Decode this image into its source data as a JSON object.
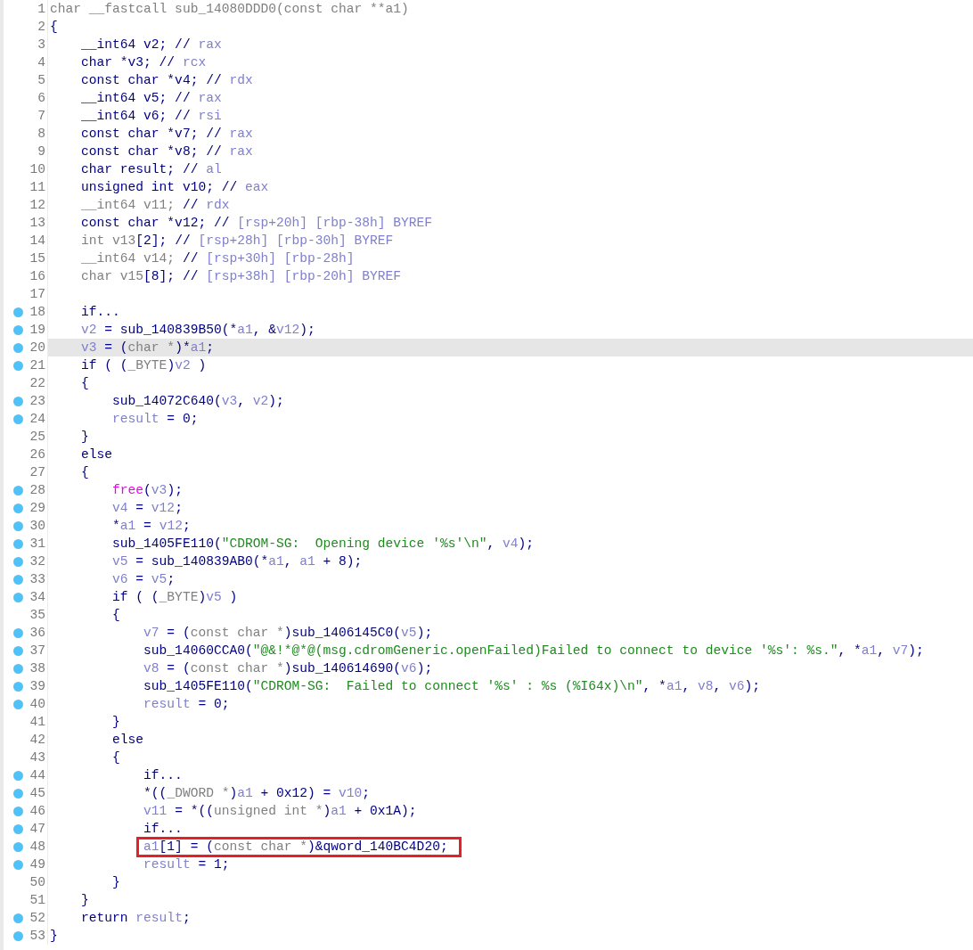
{
  "lines": [
    {
      "number": "1",
      "breakpoint": false,
      "highlighted": false,
      "boxed": false,
      "tokens": [
        {
          "kind": "gray",
          "text": "char __fastcall sub_14080DDD0(const char **a1)"
        }
      ]
    },
    {
      "number": "2",
      "breakpoint": false,
      "highlighted": false,
      "boxed": false,
      "tokens": [
        {
          "kind": "code",
          "text": "{"
        }
      ]
    },
    {
      "number": "3",
      "breakpoint": false,
      "highlighted": false,
      "boxed": false,
      "tokens": [
        {
          "kind": "code",
          "text": "    __int64 v2; // "
        },
        {
          "kind": "var",
          "text": "rax"
        }
      ]
    },
    {
      "number": "4",
      "breakpoint": false,
      "highlighted": false,
      "boxed": false,
      "tokens": [
        {
          "kind": "code",
          "text": "    char *v3; // "
        },
        {
          "kind": "var",
          "text": "rcx"
        }
      ]
    },
    {
      "number": "5",
      "breakpoint": false,
      "highlighted": false,
      "boxed": false,
      "tokens": [
        {
          "kind": "code",
          "text": "    const char *v4; // "
        },
        {
          "kind": "var",
          "text": "rdx"
        }
      ]
    },
    {
      "number": "6",
      "breakpoint": false,
      "highlighted": false,
      "boxed": false,
      "tokens": [
        {
          "kind": "code",
          "text": "    __int64 v5; // "
        },
        {
          "kind": "var",
          "text": "rax"
        }
      ]
    },
    {
      "number": "7",
      "breakpoint": false,
      "highlighted": false,
      "boxed": false,
      "tokens": [
        {
          "kind": "code",
          "text": "    __int64 v6; // "
        },
        {
          "kind": "var",
          "text": "rsi"
        }
      ]
    },
    {
      "number": "8",
      "breakpoint": false,
      "highlighted": false,
      "boxed": false,
      "tokens": [
        {
          "kind": "code",
          "text": "    const char *v7; // "
        },
        {
          "kind": "var",
          "text": "rax"
        }
      ]
    },
    {
      "number": "9",
      "breakpoint": false,
      "highlighted": false,
      "boxed": false,
      "tokens": [
        {
          "kind": "code",
          "text": "    const char *v8; // "
        },
        {
          "kind": "var",
          "text": "rax"
        }
      ]
    },
    {
      "number": "10",
      "breakpoint": false,
      "highlighted": false,
      "boxed": false,
      "tokens": [
        {
          "kind": "code",
          "text": "    char result; // "
        },
        {
          "kind": "var",
          "text": "al"
        }
      ]
    },
    {
      "number": "11",
      "breakpoint": false,
      "highlighted": false,
      "boxed": false,
      "tokens": [
        {
          "kind": "code",
          "text": "    unsigned int v10; // "
        },
        {
          "kind": "var",
          "text": "eax"
        }
      ]
    },
    {
      "number": "12",
      "breakpoint": false,
      "highlighted": false,
      "boxed": false,
      "tokens": [
        {
          "kind": "gray",
          "text": "    __int64 v11;"
        },
        {
          "kind": "code",
          "text": " // "
        },
        {
          "kind": "var",
          "text": "rdx"
        }
      ]
    },
    {
      "number": "13",
      "breakpoint": false,
      "highlighted": false,
      "boxed": false,
      "tokens": [
        {
          "kind": "code",
          "text": "    const char *v12; // "
        },
        {
          "kind": "var",
          "text": "[rsp+20h] [rbp-38h] BYREF"
        }
      ]
    },
    {
      "number": "14",
      "breakpoint": false,
      "highlighted": false,
      "boxed": false,
      "tokens": [
        {
          "kind": "gray",
          "text": "    int v13"
        },
        {
          "kind": "code",
          "text": "[2]; // "
        },
        {
          "kind": "var",
          "text": "[rsp+28h] [rbp-30h] BYREF"
        }
      ]
    },
    {
      "number": "15",
      "breakpoint": false,
      "highlighted": false,
      "boxed": false,
      "tokens": [
        {
          "kind": "gray",
          "text": "    __int64 v14;"
        },
        {
          "kind": "code",
          "text": " // "
        },
        {
          "kind": "var",
          "text": "[rsp+30h] [rbp-28h]"
        }
      ]
    },
    {
      "number": "16",
      "breakpoint": false,
      "highlighted": false,
      "boxed": false,
      "tokens": [
        {
          "kind": "gray",
          "text": "    char v15"
        },
        {
          "kind": "code",
          "text": "[8]; // "
        },
        {
          "kind": "var",
          "text": "[rsp+38h] [rbp-20h] BYREF"
        }
      ]
    },
    {
      "number": "17",
      "breakpoint": false,
      "highlighted": false,
      "boxed": false
    },
    {
      "number": "18",
      "breakpoint": true,
      "highlighted": false,
      "boxed": false,
      "tokens": [
        {
          "kind": "code",
          "text": "    if..."
        }
      ]
    },
    {
      "number": "19",
      "breakpoint": true,
      "highlighted": false,
      "boxed": false,
      "tokens": [
        {
          "kind": "var",
          "text": "    v2"
        },
        {
          "kind": "code",
          "text": " = sub_140839B50(*"
        },
        {
          "kind": "var",
          "text": "a1"
        },
        {
          "kind": "code",
          "text": ", &"
        },
        {
          "kind": "var",
          "text": "v12"
        },
        {
          "kind": "code",
          "text": ");"
        }
      ]
    },
    {
      "number": "20",
      "breakpoint": true,
      "highlighted": true,
      "boxed": false,
      "tokens": [
        {
          "kind": "var",
          "text": "    v3"
        },
        {
          "kind": "code",
          "text": " = ("
        },
        {
          "kind": "gray",
          "text": "char *"
        },
        {
          "kind": "code",
          "text": ")*"
        },
        {
          "kind": "var",
          "text": "a1"
        },
        {
          "kind": "code",
          "text": ";"
        }
      ]
    },
    {
      "number": "21",
      "breakpoint": true,
      "highlighted": false,
      "boxed": false,
      "tokens": [
        {
          "kind": "code",
          "text": "    if ( ("
        },
        {
          "kind": "gray",
          "text": "_BYTE"
        },
        {
          "kind": "code",
          "text": ")"
        },
        {
          "kind": "var",
          "text": "v2"
        },
        {
          "kind": "code",
          "text": " )"
        }
      ]
    },
    {
      "number": "22",
      "breakpoint": false,
      "highlighted": false,
      "boxed": false,
      "tokens": [
        {
          "kind": "code",
          "text": "    {"
        }
      ]
    },
    {
      "number": "23",
      "breakpoint": true,
      "highlighted": false,
      "boxed": false,
      "tokens": [
        {
          "kind": "code",
          "text": "        sub_14072C640("
        },
        {
          "kind": "var",
          "text": "v3"
        },
        {
          "kind": "code",
          "text": ", "
        },
        {
          "kind": "var",
          "text": "v2"
        },
        {
          "kind": "code",
          "text": ");"
        }
      ]
    },
    {
      "number": "24",
      "breakpoint": true,
      "highlighted": false,
      "boxed": false,
      "tokens": [
        {
          "kind": "var",
          "text": "        result"
        },
        {
          "kind": "code",
          "text": " = 0;"
        }
      ]
    },
    {
      "number": "25",
      "breakpoint": false,
      "highlighted": false,
      "boxed": false,
      "tokens": [
        {
          "kind": "code",
          "text": "    }"
        }
      ]
    },
    {
      "number": "26",
      "breakpoint": false,
      "highlighted": false,
      "boxed": false,
      "tokens": [
        {
          "kind": "code",
          "text": "    else"
        }
      ]
    },
    {
      "number": "27",
      "breakpoint": false,
      "highlighted": false,
      "boxed": false,
      "tokens": [
        {
          "kind": "code",
          "text": "    {"
        }
      ]
    },
    {
      "number": "28",
      "breakpoint": true,
      "highlighted": false,
      "boxed": false,
      "tokens": [
        {
          "kind": "library",
          "text": "        free"
        },
        {
          "kind": "code",
          "text": "("
        },
        {
          "kind": "var",
          "text": "v3"
        },
        {
          "kind": "code",
          "text": ");"
        }
      ]
    },
    {
      "number": "29",
      "breakpoint": true,
      "highlighted": false,
      "boxed": false,
      "tokens": [
        {
          "kind": "var",
          "text": "        v4"
        },
        {
          "kind": "code",
          "text": " = "
        },
        {
          "kind": "var",
          "text": "v12"
        },
        {
          "kind": "code",
          "text": ";"
        }
      ]
    },
    {
      "number": "30",
      "breakpoint": true,
      "highlighted": false,
      "boxed": false,
      "tokens": [
        {
          "kind": "code",
          "text": "        *"
        },
        {
          "kind": "var",
          "text": "a1"
        },
        {
          "kind": "code",
          "text": " = "
        },
        {
          "kind": "var",
          "text": "v12"
        },
        {
          "kind": "code",
          "text": ";"
        }
      ]
    },
    {
      "number": "31",
      "breakpoint": true,
      "highlighted": false,
      "boxed": false,
      "tokens": [
        {
          "kind": "code",
          "text": "        sub_1405FE110("
        },
        {
          "kind": "string",
          "text": "\"CDROM-SG:  Opening device '%s'\\n\""
        },
        {
          "kind": "code",
          "text": ", "
        },
        {
          "kind": "var",
          "text": "v4"
        },
        {
          "kind": "code",
          "text": ");"
        }
      ]
    },
    {
      "number": "32",
      "breakpoint": true,
      "highlighted": false,
      "boxed": false,
      "tokens": [
        {
          "kind": "var",
          "text": "        v5"
        },
        {
          "kind": "code",
          "text": " = sub_140839AB0(*"
        },
        {
          "kind": "var",
          "text": "a1"
        },
        {
          "kind": "code",
          "text": ", "
        },
        {
          "kind": "var",
          "text": "a1"
        },
        {
          "kind": "code",
          "text": " + 8);"
        }
      ]
    },
    {
      "number": "33",
      "breakpoint": true,
      "highlighted": false,
      "boxed": false,
      "tokens": [
        {
          "kind": "var",
          "text": "        v6"
        },
        {
          "kind": "code",
          "text": " = "
        },
        {
          "kind": "var",
          "text": "v5"
        },
        {
          "kind": "code",
          "text": ";"
        }
      ]
    },
    {
      "number": "34",
      "breakpoint": true,
      "highlighted": false,
      "boxed": false,
      "tokens": [
        {
          "kind": "code",
          "text": "        if ( ("
        },
        {
          "kind": "gray",
          "text": "_BYTE"
        },
        {
          "kind": "code",
          "text": ")"
        },
        {
          "kind": "var",
          "text": "v5"
        },
        {
          "kind": "code",
          "text": " )"
        }
      ]
    },
    {
      "number": "35",
      "breakpoint": false,
      "highlighted": false,
      "boxed": false,
      "tokens": [
        {
          "kind": "code",
          "text": "        {"
        }
      ]
    },
    {
      "number": "36",
      "breakpoint": true,
      "highlighted": false,
      "boxed": false,
      "tokens": [
        {
          "kind": "var",
          "text": "            v7"
        },
        {
          "kind": "code",
          "text": " = ("
        },
        {
          "kind": "gray",
          "text": "const char *"
        },
        {
          "kind": "code",
          "text": ")sub_1406145C0("
        },
        {
          "kind": "var",
          "text": "v5"
        },
        {
          "kind": "code",
          "text": ");"
        }
      ]
    },
    {
      "number": "37",
      "breakpoint": true,
      "highlighted": false,
      "boxed": false,
      "tokens": [
        {
          "kind": "code",
          "text": "            sub_14060CCA0("
        },
        {
          "kind": "string",
          "text": "\"@&!*@*@(msg.cdromGeneric.openFailed)Failed to connect to device '%s': %s.\""
        },
        {
          "kind": "code",
          "text": ", *"
        },
        {
          "kind": "var",
          "text": "a1"
        },
        {
          "kind": "code",
          "text": ", "
        },
        {
          "kind": "var",
          "text": "v7"
        },
        {
          "kind": "code",
          "text": ");"
        }
      ]
    },
    {
      "number": "38",
      "breakpoint": true,
      "highlighted": false,
      "boxed": false,
      "tokens": [
        {
          "kind": "var",
          "text": "            v8"
        },
        {
          "kind": "code",
          "text": " = ("
        },
        {
          "kind": "gray",
          "text": "const char *"
        },
        {
          "kind": "code",
          "text": ")sub_140614690("
        },
        {
          "kind": "var",
          "text": "v6"
        },
        {
          "kind": "code",
          "text": ");"
        }
      ]
    },
    {
      "number": "39",
      "breakpoint": true,
      "highlighted": false,
      "boxed": false,
      "tokens": [
        {
          "kind": "code",
          "text": "            sub_1405FE110("
        },
        {
          "kind": "string",
          "text": "\"CDROM-SG:  Failed to connect '%s' : %s (%I64x)\\n\""
        },
        {
          "kind": "code",
          "text": ", *"
        },
        {
          "kind": "var",
          "text": "a1"
        },
        {
          "kind": "code",
          "text": ", "
        },
        {
          "kind": "var",
          "text": "v8"
        },
        {
          "kind": "code",
          "text": ", "
        },
        {
          "kind": "var",
          "text": "v6"
        },
        {
          "kind": "code",
          "text": ");"
        }
      ]
    },
    {
      "number": "40",
      "breakpoint": true,
      "highlighted": false,
      "boxed": false,
      "tokens": [
        {
          "kind": "var",
          "text": "            result"
        },
        {
          "kind": "code",
          "text": " = 0;"
        }
      ]
    },
    {
      "number": "41",
      "breakpoint": false,
      "highlighted": false,
      "boxed": false,
      "tokens": [
        {
          "kind": "code",
          "text": "        }"
        }
      ]
    },
    {
      "number": "42",
      "breakpoint": false,
      "highlighted": false,
      "boxed": false,
      "tokens": [
        {
          "kind": "code",
          "text": "        else"
        }
      ]
    },
    {
      "number": "43",
      "breakpoint": false,
      "highlighted": false,
      "boxed": false,
      "tokens": [
        {
          "kind": "code",
          "text": "        {"
        }
      ]
    },
    {
      "number": "44",
      "breakpoint": true,
      "highlighted": false,
      "boxed": false,
      "tokens": [
        {
          "kind": "code",
          "text": "            if..."
        }
      ]
    },
    {
      "number": "45",
      "breakpoint": true,
      "highlighted": false,
      "boxed": false,
      "tokens": [
        {
          "kind": "code",
          "text": "            *(("
        },
        {
          "kind": "gray",
          "text": "_DWORD *"
        },
        {
          "kind": "code",
          "text": ")"
        },
        {
          "kind": "var",
          "text": "a1"
        },
        {
          "kind": "code",
          "text": " + 0x12) = "
        },
        {
          "kind": "var",
          "text": "v10"
        },
        {
          "kind": "code",
          "text": ";"
        }
      ]
    },
    {
      "number": "46",
      "breakpoint": true,
      "highlighted": false,
      "boxed": false,
      "tokens": [
        {
          "kind": "var",
          "text": "            v11"
        },
        {
          "kind": "code",
          "text": " = *(("
        },
        {
          "kind": "gray",
          "text": "unsigned int *"
        },
        {
          "kind": "code",
          "text": ")"
        },
        {
          "kind": "var",
          "text": "a1"
        },
        {
          "kind": "code",
          "text": " + 0x1A);"
        }
      ]
    },
    {
      "number": "47",
      "breakpoint": true,
      "highlighted": false,
      "boxed": false,
      "tokens": [
        {
          "kind": "code",
          "text": "            if..."
        }
      ]
    },
    {
      "number": "48",
      "breakpoint": true,
      "highlighted": false,
      "boxed": true,
      "tokens": [
        {
          "kind": "var",
          "text": "            a1"
        },
        {
          "kind": "code",
          "text": "[1] = ("
        },
        {
          "kind": "gray",
          "text": "const char *"
        },
        {
          "kind": "code",
          "text": ")&qword_140BC4D20;"
        }
      ]
    },
    {
      "number": "49",
      "breakpoint": true,
      "highlighted": false,
      "boxed": false,
      "tokens": [
        {
          "kind": "var",
          "text": "            result"
        },
        {
          "kind": "code",
          "text": " = 1;"
        }
      ]
    },
    {
      "number": "50",
      "breakpoint": false,
      "highlighted": false,
      "boxed": false,
      "tokens": [
        {
          "kind": "code",
          "text": "        }"
        }
      ]
    },
    {
      "number": "51",
      "breakpoint": false,
      "highlighted": false,
      "boxed": false,
      "tokens": [
        {
          "kind": "code",
          "text": "    }"
        }
      ]
    },
    {
      "number": "52",
      "breakpoint": true,
      "highlighted": false,
      "boxed": false,
      "tokens": [
        {
          "kind": "code",
          "text": "    return "
        },
        {
          "kind": "var",
          "text": "result"
        },
        {
          "kind": "code",
          "text": ";"
        }
      ]
    },
    {
      "number": "53",
      "breakpoint": true,
      "highlighted": false,
      "boxed": false,
      "tokens": [
        {
          "kind": "code",
          "text": "}"
        }
      ]
    }
  ]
}
